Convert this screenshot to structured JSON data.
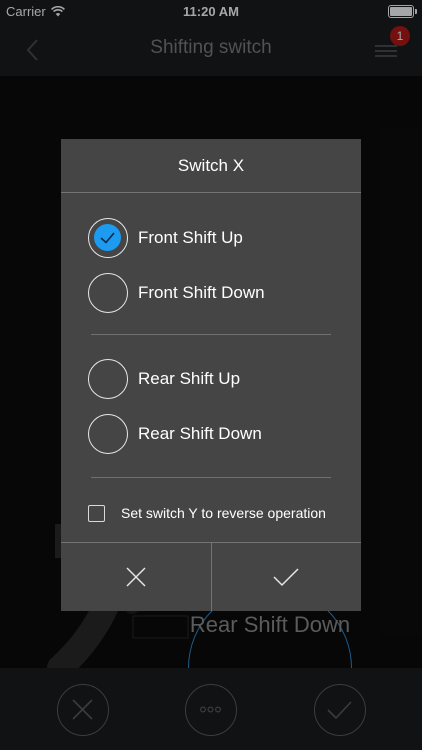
{
  "status_bar": {
    "carrier": "Carrier",
    "time": "11:20 AM"
  },
  "nav": {
    "title": "Shifting switch",
    "badge_count": "1"
  },
  "background": {
    "circle_label": "Rear Shift Down"
  },
  "dialog": {
    "title": "Switch X",
    "options": [
      {
        "label": "Front Shift Up",
        "selected": true
      },
      {
        "label": "Front Shift Down",
        "selected": false
      },
      {
        "label": "Rear Shift Up",
        "selected": false
      },
      {
        "label": "Rear Shift Down",
        "selected": false
      }
    ],
    "reverse_label": "Set switch Y to reverse operation",
    "reverse_checked": false
  },
  "colors": {
    "accent": "#1d9bf0",
    "badge": "#b31a1a",
    "dialog_bg": "#454545",
    "circle_outline": "#2d8fd8"
  },
  "icons": {
    "back": "chevron-left-icon",
    "menu": "hamburger-menu-icon",
    "cancel": "close-icon",
    "confirm": "check-icon",
    "more": "more-dots-icon",
    "wifi": "wifi-icon",
    "battery": "battery-icon"
  }
}
